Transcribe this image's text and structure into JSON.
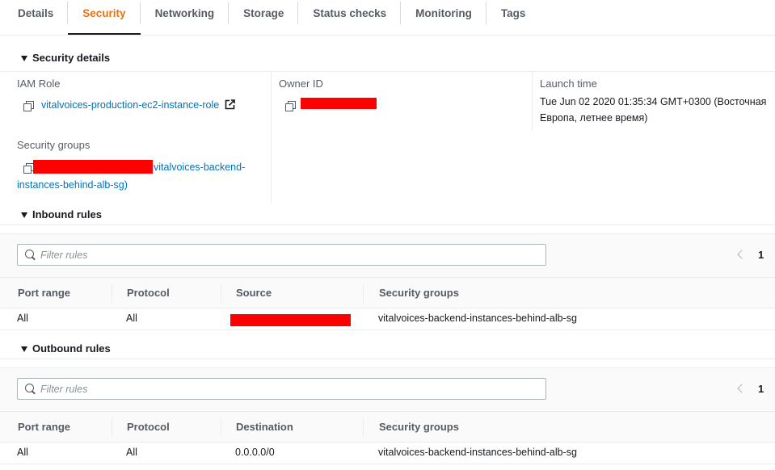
{
  "tabs": [
    "Details",
    "Security",
    "Networking",
    "Storage",
    "Status checks",
    "Monitoring",
    "Tags"
  ],
  "active_tab": "Security",
  "security_details": {
    "heading": "Security details",
    "iam_role_label": "IAM Role",
    "iam_role_value": "vitalvoices-production-ec2-instance-role",
    "owner_id_label": "Owner ID",
    "launch_time_label": "Launch time",
    "launch_time_line1": "Tue Jun 02 2020 01:35:34 GMT+0300 (Восточная",
    "launch_time_line2": "Европа, летнее время)",
    "security_groups_label": "Security groups",
    "security_groups_line1": "vitalvoices-backend-",
    "security_groups_line2": "instances-behind-alb-sg)"
  },
  "inbound": {
    "heading": "Inbound rules",
    "filter_placeholder": "Filter rules",
    "page": "1",
    "columns": [
      "Port range",
      "Protocol",
      "Source",
      "Security groups"
    ],
    "rows": [
      {
        "port_range": "All",
        "protocol": "All",
        "security_groups": "vitalvoices-backend-instances-behind-alb-sg"
      }
    ]
  },
  "outbound": {
    "heading": "Outbound rules",
    "filter_placeholder": "Filter rules",
    "page": "1",
    "columns": [
      "Port range",
      "Protocol",
      "Destination",
      "Security groups"
    ],
    "rows": [
      {
        "port_range": "All",
        "protocol": "All",
        "destination": "0.0.0.0/0",
        "security_groups": "vitalvoices-backend-instances-behind-alb-sg"
      }
    ]
  },
  "colors": {
    "accent": "#ec7211",
    "link": "#0073bb",
    "redaction": "#ff0000"
  }
}
